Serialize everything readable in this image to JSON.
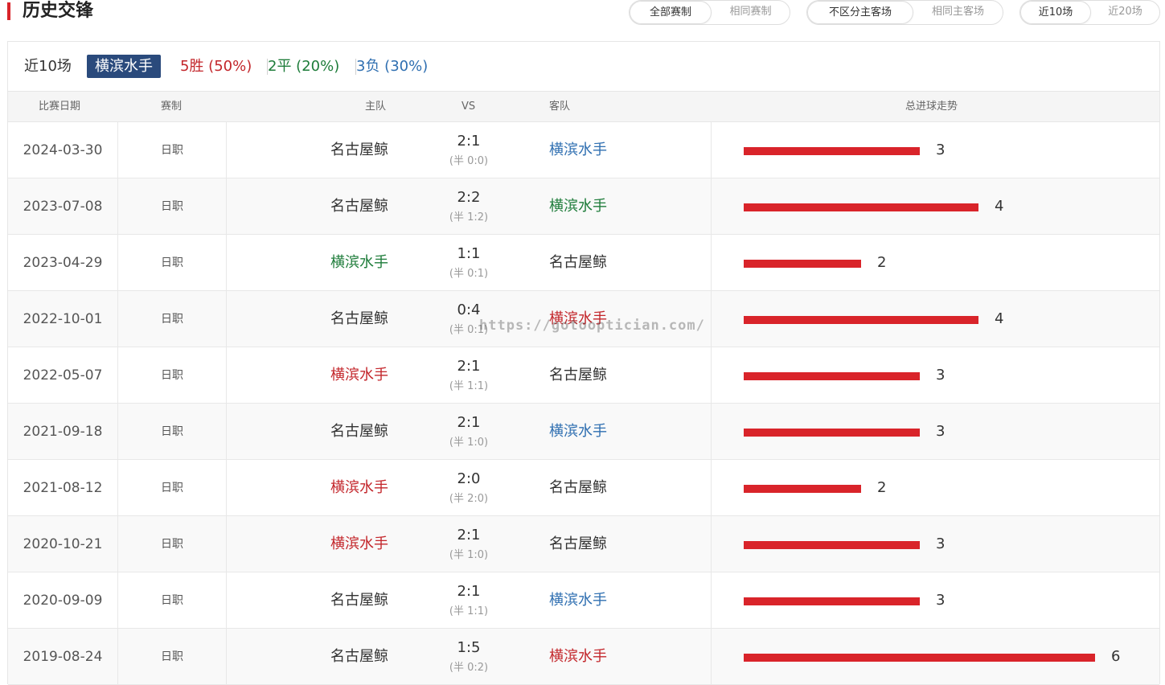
{
  "title": "历史交锋",
  "filters": {
    "competition": [
      "全部赛制",
      "相同赛制"
    ],
    "venue": [
      "不区分主客场",
      "相同主客场"
    ],
    "range": [
      "近10场",
      "近20场"
    ]
  },
  "summary": {
    "label": "近10场",
    "team": "横滨水手",
    "wins": "5胜 (50%)",
    "draws": "2平 (20%)",
    "losses": "3负 (30%)"
  },
  "columns": {
    "date": "比赛日期",
    "competition": "赛制",
    "home": "主队",
    "vs": "VS",
    "away": "客队",
    "trend": "总进球走势"
  },
  "matches": [
    {
      "date": "2024-03-30",
      "competition": "日职",
      "home": "名古屋鲸",
      "home_color": "dark",
      "score": "2:1",
      "half": "(半 0:0)",
      "away": "横滨水手",
      "away_color": "blue",
      "total": 3
    },
    {
      "date": "2023-07-08",
      "competition": "日职",
      "home": "名古屋鲸",
      "home_color": "dark",
      "score": "2:2",
      "half": "(半 1:2)",
      "away": "横滨水手",
      "away_color": "green",
      "total": 4
    },
    {
      "date": "2023-04-29",
      "competition": "日职",
      "home": "横滨水手",
      "home_color": "green",
      "score": "1:1",
      "half": "(半 0:1)",
      "away": "名古屋鲸",
      "away_color": "dark",
      "total": 2
    },
    {
      "date": "2022-10-01",
      "competition": "日职",
      "home": "名古屋鲸",
      "home_color": "dark",
      "score": "0:4",
      "half": "(半 0:1)",
      "away": "横滨水手",
      "away_color": "red",
      "total": 4
    },
    {
      "date": "2022-05-07",
      "competition": "日职",
      "home": "横滨水手",
      "home_color": "red",
      "score": "2:1",
      "half": "(半 1:1)",
      "away": "名古屋鲸",
      "away_color": "dark",
      "total": 3
    },
    {
      "date": "2021-09-18",
      "competition": "日职",
      "home": "名古屋鲸",
      "home_color": "dark",
      "score": "2:1",
      "half": "(半 1:0)",
      "away": "横滨水手",
      "away_color": "blue",
      "total": 3
    },
    {
      "date": "2021-08-12",
      "competition": "日职",
      "home": "横滨水手",
      "home_color": "red",
      "score": "2:0",
      "half": "(半 2:0)",
      "away": "名古屋鲸",
      "away_color": "dark",
      "total": 2
    },
    {
      "date": "2020-10-21",
      "competition": "日职",
      "home": "横滨水手",
      "home_color": "red",
      "score": "2:1",
      "half": "(半 1:0)",
      "away": "名古屋鲸",
      "away_color": "dark",
      "total": 3
    },
    {
      "date": "2020-09-09",
      "competition": "日职",
      "home": "名古屋鲸",
      "home_color": "dark",
      "score": "2:1",
      "half": "(半 1:1)",
      "away": "横滨水手",
      "away_color": "blue",
      "total": 3
    },
    {
      "date": "2019-08-24",
      "competition": "日职",
      "home": "名古屋鲸",
      "home_color": "dark",
      "score": "1:5",
      "half": "(半 0:2)",
      "away": "横滨水手",
      "away_color": "red",
      "total": 6
    }
  ],
  "watermark": "https://gotooptician.com/",
  "colors": {
    "accent": "#d9242a",
    "win": "#c3262b",
    "draw": "#1e7c3a",
    "loss": "#2f6fb1",
    "badge": "#2a4a7c"
  }
}
